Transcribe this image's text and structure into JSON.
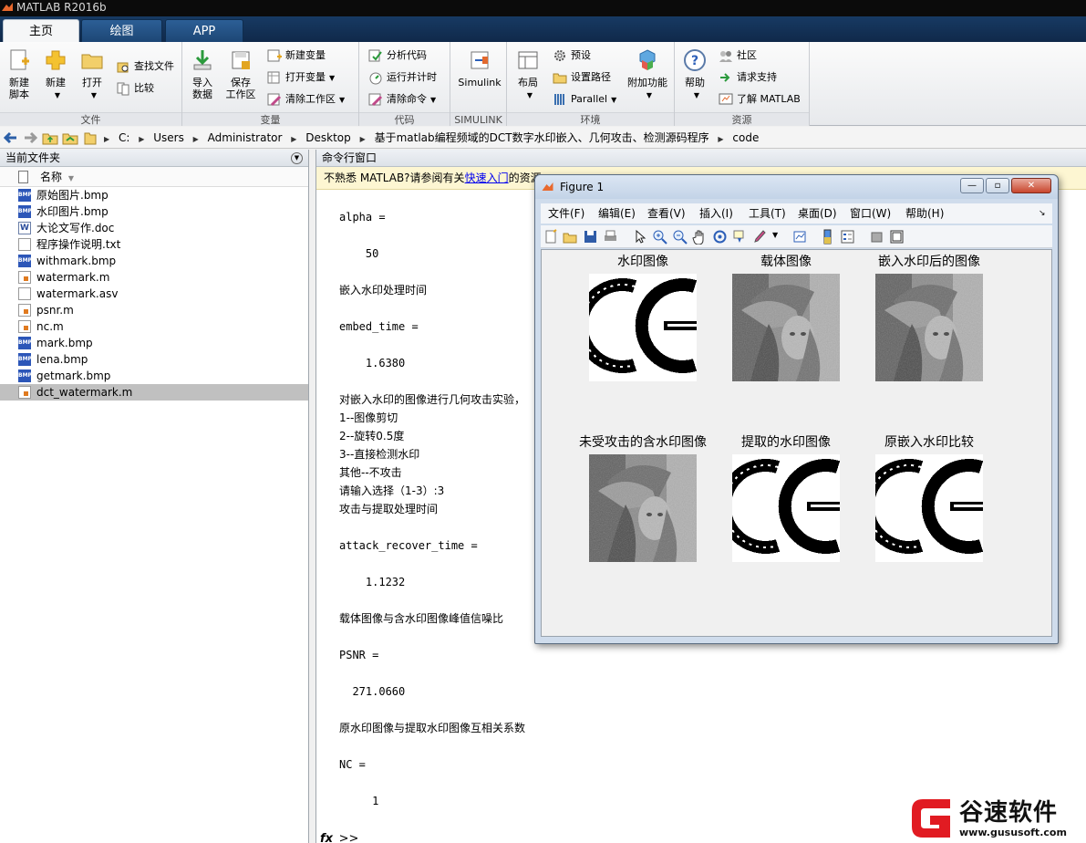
{
  "app": {
    "title": "MATLAB R2016b"
  },
  "ribbon": {
    "tabs": [
      {
        "label": "主页"
      },
      {
        "label": "绘图"
      },
      {
        "label": "APP"
      }
    ],
    "groups": {
      "file": {
        "label": "文件",
        "new_script": "新建\n脚本",
        "new": "新建",
        "open": "打开",
        "find_files": "查找文件",
        "compare": "比较"
      },
      "variable": {
        "label": "变量",
        "import_data": "导入\n数据",
        "save_workspace": "保存\n工作区",
        "new_variable": "新建变量",
        "open_variable": "打开变量",
        "clear_workspace": "清除工作区"
      },
      "code": {
        "label": "代码",
        "analyze_code": "分析代码",
        "run_and_time": "运行并计时",
        "clear_commands": "清除命令"
      },
      "simulink": {
        "label": "SIMULINK",
        "simulink": "Simulink"
      },
      "environment": {
        "label": "环境",
        "layout": "布局",
        "preferences": "预设",
        "set_path": "设置路径",
        "parallel": "Parallel",
        "add_ons": "附加功能"
      },
      "resources": {
        "label": "资源",
        "help": "帮助",
        "community": "社区",
        "request_support": "请求支持",
        "learn_matlab": "了解 MATLAB"
      }
    }
  },
  "address": {
    "path": [
      "C:",
      "Users",
      "Administrator",
      "Desktop",
      "基于matlab编程频域的DCT数字水印嵌入、几何攻击、检测源码程序",
      "code"
    ]
  },
  "current_folder": {
    "title": "当前文件夹",
    "column_name": "名称",
    "files": [
      {
        "name": "原始图片.bmp",
        "type": "bmp"
      },
      {
        "name": "水印图片.bmp",
        "type": "bmp"
      },
      {
        "name": "大论文写作.doc",
        "type": "doc"
      },
      {
        "name": "程序操作说明.txt",
        "type": "txt"
      },
      {
        "name": "withmark.bmp",
        "type": "bmp"
      },
      {
        "name": "watermark.m",
        "type": "m"
      },
      {
        "name": "watermark.asv",
        "type": "asv"
      },
      {
        "name": "psnr.m",
        "type": "m"
      },
      {
        "name": "nc.m",
        "type": "m"
      },
      {
        "name": "mark.bmp",
        "type": "bmp"
      },
      {
        "name": "lena.bmp",
        "type": "bmp"
      },
      {
        "name": "getmark.bmp",
        "type": "bmp"
      },
      {
        "name": "dct_watermark.m",
        "type": "m",
        "selected": true
      }
    ]
  },
  "command_window": {
    "title": "命令行窗口",
    "info_prefix": "不熟悉 MATLAB?请参阅有关",
    "info_link": "快速入门",
    "info_suffix": "的资源。",
    "lines": [
      {
        "text": "",
        "mono": false
      },
      {
        "text": "alpha =",
        "mono": true
      },
      {
        "text": "",
        "mono": false
      },
      {
        "text": "    50",
        "mono": true
      },
      {
        "text": "",
        "mono": false
      },
      {
        "text": "嵌入水印处理时间",
        "mono": false
      },
      {
        "text": "",
        "mono": false
      },
      {
        "text": "embed_time =",
        "mono": true
      },
      {
        "text": "",
        "mono": false
      },
      {
        "text": "    1.6380",
        "mono": true
      },
      {
        "text": "",
        "mono": false
      },
      {
        "text": "对嵌入水印的图像进行几何攻击实验，",
        "mono": false
      },
      {
        "text": "1--图像剪切",
        "mono": false
      },
      {
        "text": "2--旋转0.5度",
        "mono": false
      },
      {
        "text": "3--直接检测水印",
        "mono": false
      },
      {
        "text": "其他--不攻击",
        "mono": false
      },
      {
        "text": "请输入选择（1-3）:3",
        "mono": false
      },
      {
        "text": "攻击与提取处理时间",
        "mono": false
      },
      {
        "text": "",
        "mono": false
      },
      {
        "text": "attack_recover_time =",
        "mono": true
      },
      {
        "text": "",
        "mono": false
      },
      {
        "text": "    1.1232",
        "mono": true
      },
      {
        "text": "",
        "mono": false
      },
      {
        "text": "载体图像与含水印图像峰值信噪比",
        "mono": false
      },
      {
        "text": "",
        "mono": false
      },
      {
        "text": "PSNR =",
        "mono": true
      },
      {
        "text": "",
        "mono": false
      },
      {
        "text": "  271.0660",
        "mono": true
      },
      {
        "text": "",
        "mono": false
      },
      {
        "text": "原水印图像与提取水印图像互相关系数",
        "mono": false
      },
      {
        "text": "",
        "mono": false
      },
      {
        "text": "NC =",
        "mono": true
      },
      {
        "text": "",
        "mono": false
      },
      {
        "text": "     1",
        "mono": true
      }
    ],
    "prompt_symbol": "fx",
    "prompt": ">>"
  },
  "figure": {
    "title": "Figure 1",
    "menu": [
      "文件(F)",
      "编辑(E)",
      "查看(V)",
      "插入(I)",
      "工具(T)",
      "桌面(D)",
      "窗口(W)",
      "帮助(H)"
    ],
    "subplots": [
      {
        "title": "水印图像",
        "image": "ce"
      },
      {
        "title": "载体图像",
        "image": "lena"
      },
      {
        "title": "嵌入水印后的图像",
        "image": "lena"
      },
      {
        "title": "未受攻击的含水印图像",
        "image": "lena"
      },
      {
        "title": "提取的水印图像",
        "image": "ce"
      },
      {
        "title": "原嵌入水印比较",
        "image": "ce"
      }
    ]
  },
  "watermark_logo": {
    "name": "谷速软件",
    "url": "www.gususoft.com"
  }
}
